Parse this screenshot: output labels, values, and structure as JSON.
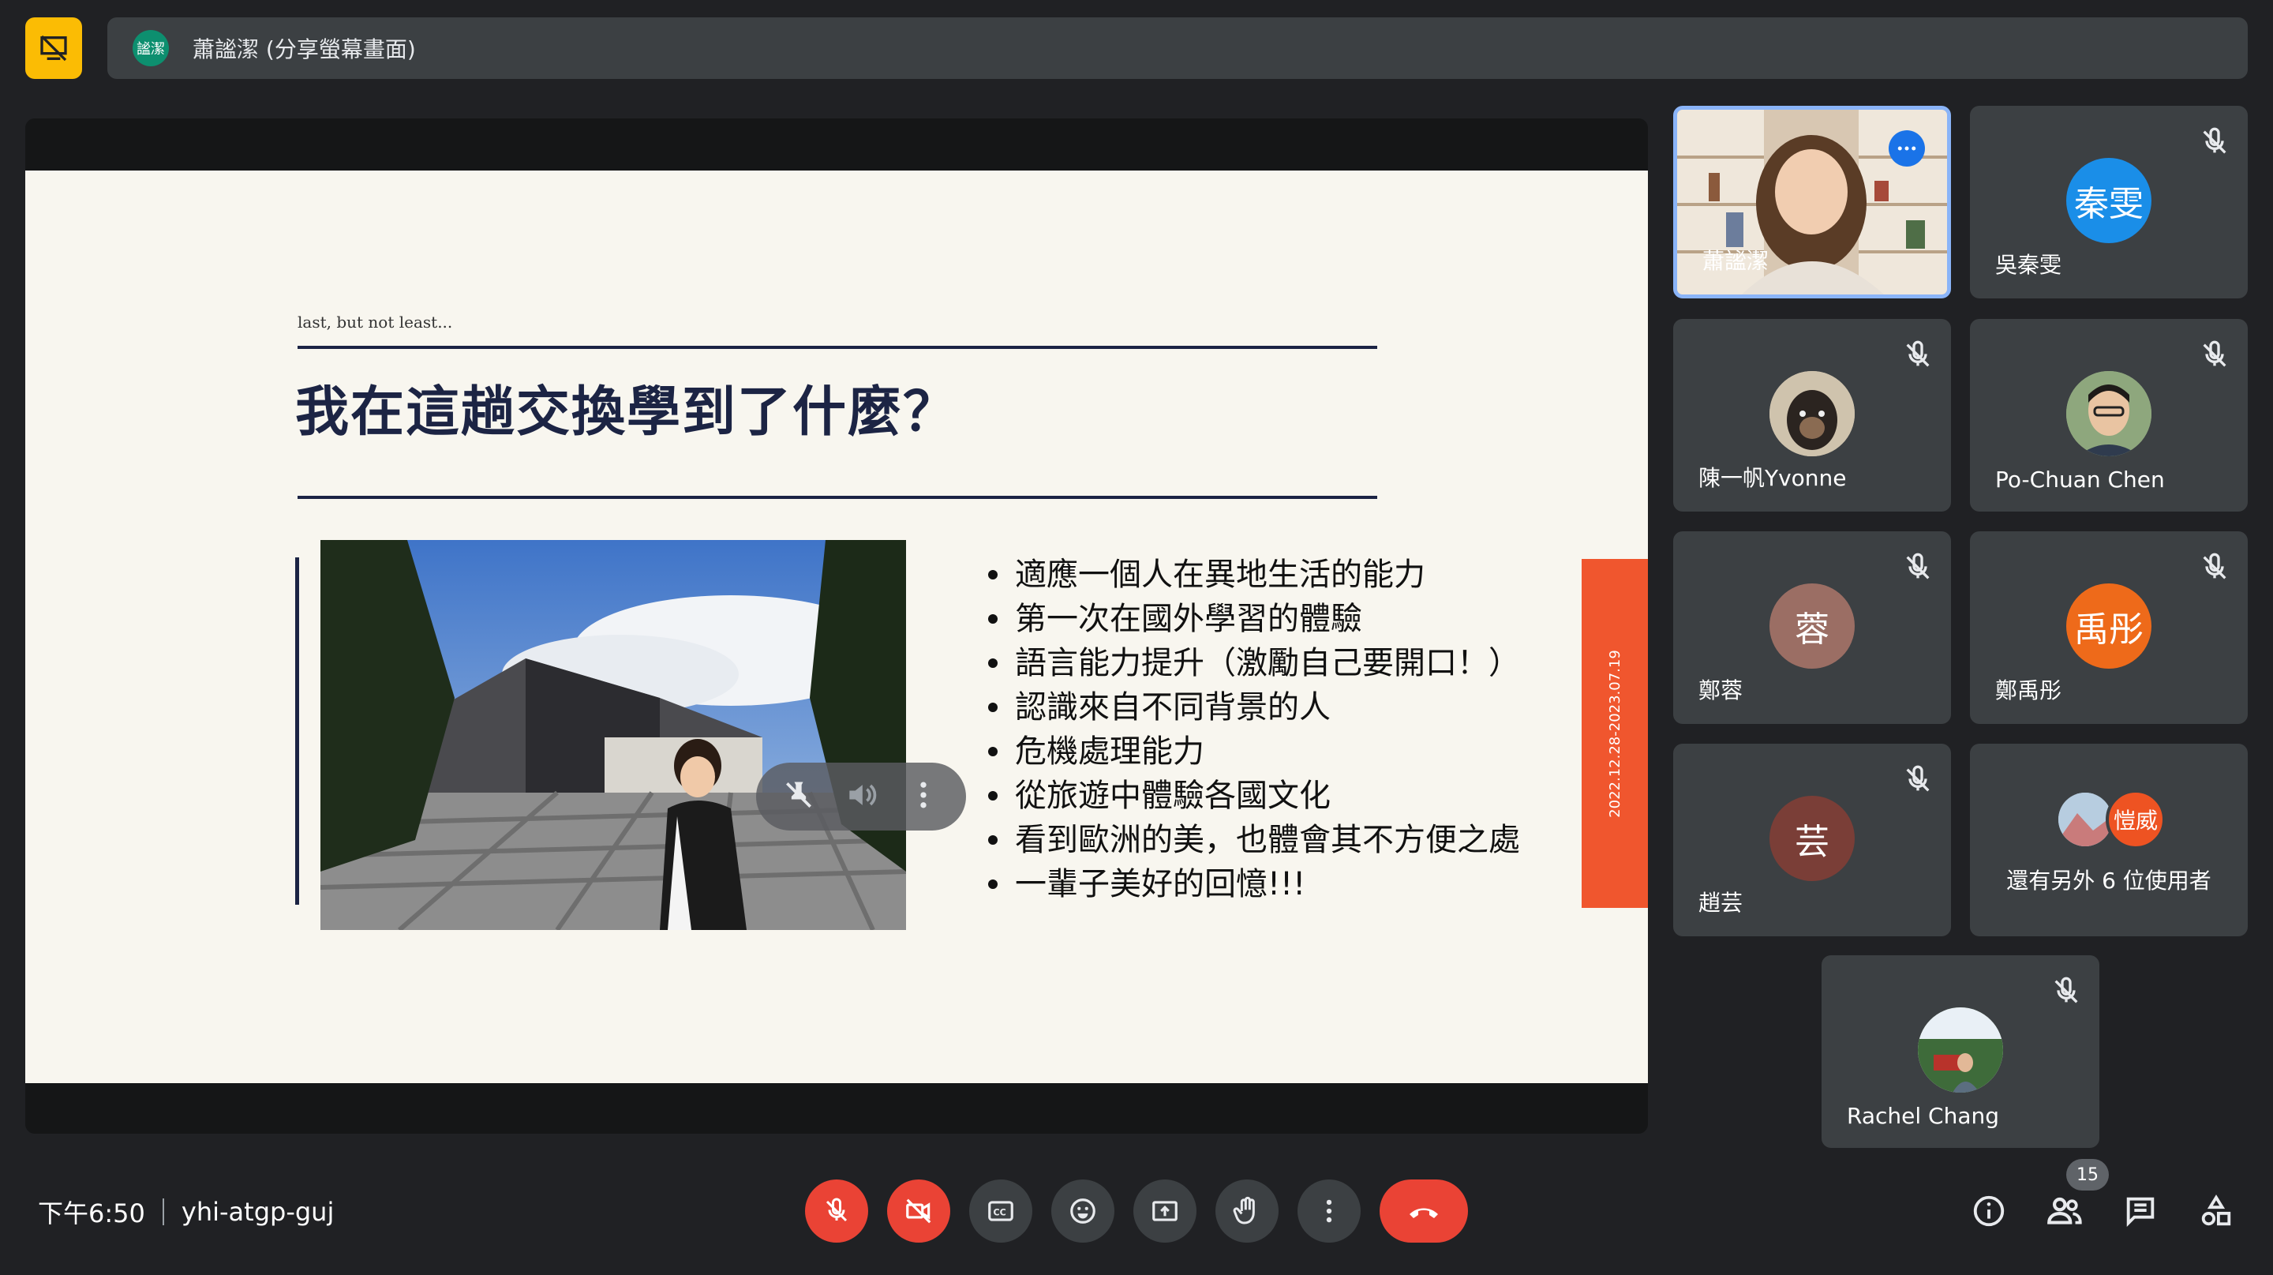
{
  "top": {
    "presenter_avatar_text": "謐潔",
    "presenter_title": "蕭謐潔 (分享螢幕畫面)"
  },
  "slide": {
    "kicker": "last, but not least...",
    "heading": "我在這趟交換學到了什麼？",
    "bullets": [
      "適應一個人在異地生活的能力",
      "第一次在國外學習的體驗",
      "語言能力提升（激勵自己要開口！）",
      "認識來自不同背景的人",
      "危機處理能力",
      "從旅遊中體驗各國文化",
      "看到歐洲的美，也體會其不方便之處",
      "一輩子美好的回憶!!!"
    ],
    "date_band": "2022.12.28-2023.07.19"
  },
  "participants": [
    {
      "name": "蕭謐潔",
      "avatar": "",
      "color": "",
      "muted": false,
      "speaking": true
    },
    {
      "name": "吳秦雯",
      "avatar": "秦雯",
      "color": "#1a8ee8",
      "muted": true
    },
    {
      "name": "陳一帆Yvonne",
      "avatar": "",
      "color": "#8a7a68",
      "muted": true
    },
    {
      "name": "Po-Chuan Chen",
      "avatar": "",
      "color": "#9bb08a",
      "muted": true
    },
    {
      "name": "鄭蓉",
      "avatar": "蓉",
      "color": "#9b6e64",
      "muted": true
    },
    {
      "name": "鄭禹彤",
      "avatar": "禹彤",
      "color": "#ee6a1a",
      "muted": true
    },
    {
      "name": "趙芸",
      "avatar": "芸",
      "color": "#7a3e37",
      "muted": true
    },
    {
      "name": "Rachel Chang",
      "avatar": "",
      "color": "#6b8e5a",
      "muted": true
    }
  ],
  "others": {
    "avatar_text": "愷威",
    "label": "還有另外 6 位使用者"
  },
  "bottom": {
    "time": "下午6:50",
    "meeting_code": "yhi-atgp-guj",
    "participants_count": "15"
  },
  "icons": {
    "mic": "mic-off-icon",
    "camera": "camera-off-icon",
    "captions": "captions-icon",
    "emoji": "emoji-icon",
    "present": "present-icon",
    "hand": "raise-hand-icon",
    "more": "more-vert-icon",
    "hangup": "call-end-icon",
    "info": "info-icon",
    "people": "people-icon",
    "chat": "chat-icon",
    "activities": "activities-icon"
  },
  "colors": {
    "accent_red": "#ea4335",
    "accent_blue": "#1a73e8",
    "presenting_yellow": "#fbbc04",
    "slide_band": "#f0562e"
  }
}
